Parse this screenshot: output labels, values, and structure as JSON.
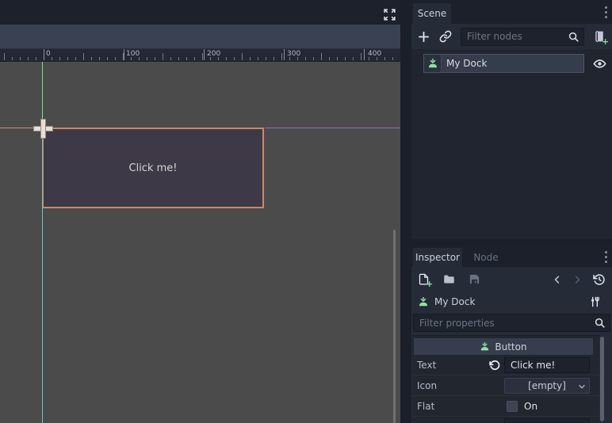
{
  "colors": {
    "accent_green": "#8fe3a2",
    "selection_orange": "#cf8765",
    "axis_green": "#7ce089",
    "guide_teal": "#6fc0bd",
    "axis_red": "#dd8878",
    "guide_violet": "#9a68bb",
    "canvas_gray": "#4b4b4b",
    "panel": "#262b38"
  },
  "viewport": {
    "ruler_labels": [
      "0",
      "100",
      "200",
      "300",
      "400"
    ],
    "button_label": "Click me!"
  },
  "scene": {
    "tab": "Scene",
    "filter_placeholder": "Filter nodes",
    "node_name": "My Dock"
  },
  "inspector": {
    "tab_inspector": "Inspector",
    "tab_node": "Node",
    "node_name": "My Dock",
    "filter_placeholder": "Filter properties",
    "category": "Button",
    "properties": [
      {
        "label": "Text",
        "value": "Click me!"
      },
      {
        "label": "Icon",
        "value": "[empty]"
      },
      {
        "label": "Flat",
        "value": "On"
      }
    ]
  },
  "icons": [
    "expand-icon",
    "plus-icon",
    "link-icon",
    "search-icon",
    "attach-script-icon",
    "eye-icon",
    "kebab-menu-icon",
    "new-resource-icon",
    "folder-icon",
    "save-icon",
    "back-icon",
    "forward-icon",
    "history-icon",
    "tools-icon",
    "revert-icon",
    "chevron-down-icon",
    "button-node-icon"
  ]
}
